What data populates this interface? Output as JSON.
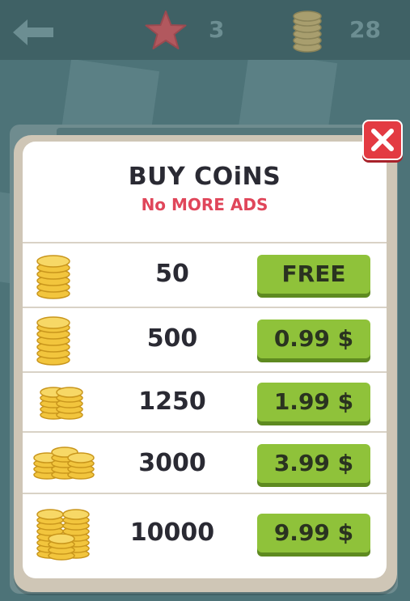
{
  "topbar": {
    "back_icon": "back-arrow-icon",
    "star_icon": "star-icon",
    "star_count": "3",
    "coin_icon": "coin-stack-icon",
    "coin_count": "28"
  },
  "popup": {
    "title": "BUY COiNS",
    "subtitle": "No MORE ADS",
    "close_icon": "close-icon",
    "items": [
      {
        "amount": "50",
        "price": "FREE",
        "icon": "coin-stack-small-icon"
      },
      {
        "amount": "500",
        "price": "0.99 $",
        "icon": "coin-stack-medium-icon"
      },
      {
        "amount": "1250",
        "price": "1.99 $",
        "icon": "coin-stacks-two-icon"
      },
      {
        "amount": "3000",
        "price": "3.99 $",
        "icon": "coin-stacks-three-icon"
      },
      {
        "amount": "10000",
        "price": "9.99 $",
        "icon": "coin-pile-large-icon"
      }
    ]
  },
  "colors": {
    "accent_green": "#8fc23a",
    "title_dark": "#2a2a33",
    "subtitle_red": "#e0465a",
    "close_red": "#e33a42",
    "coin_gold": "#f2c53d"
  }
}
